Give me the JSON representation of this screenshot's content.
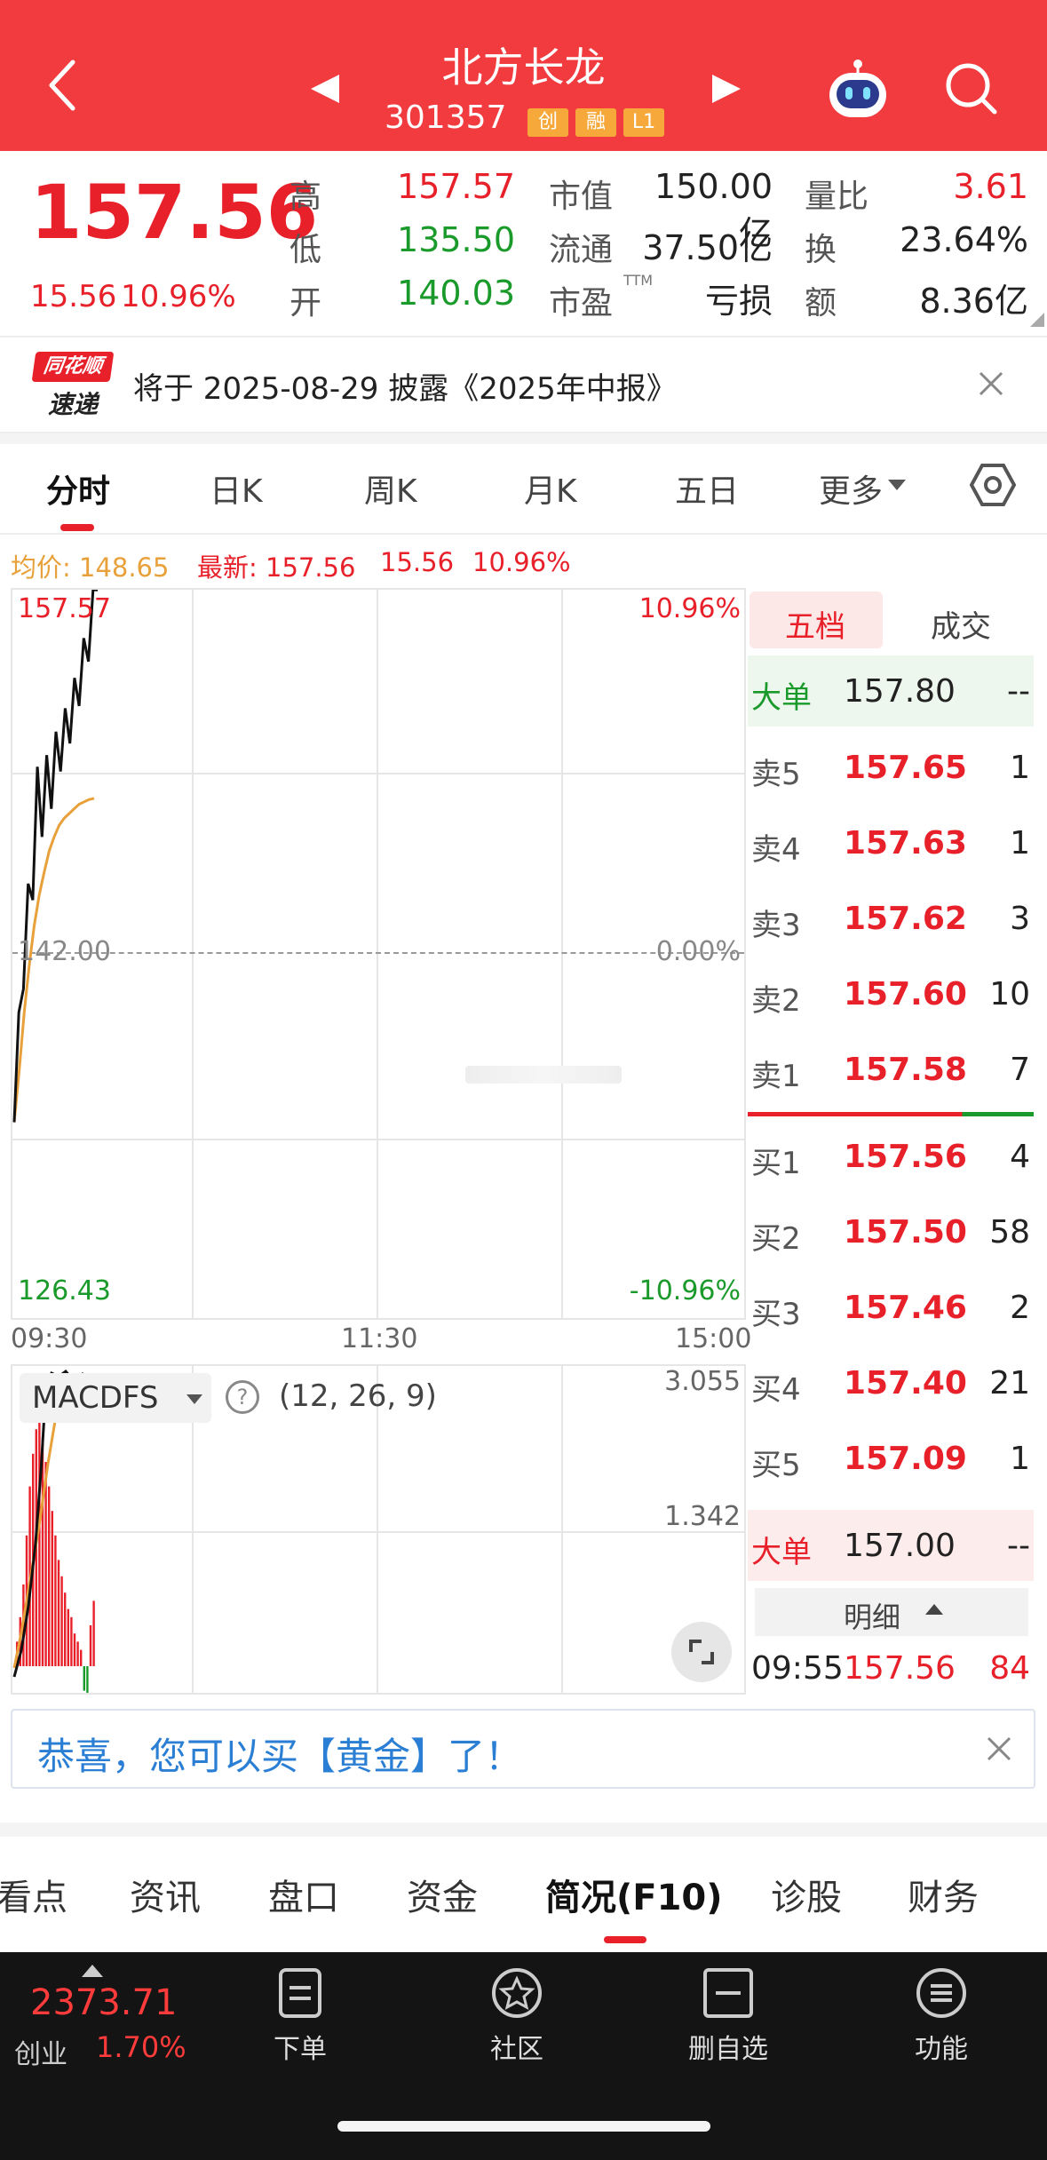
{
  "header": {
    "title": "北方长龙",
    "code": "301357",
    "tags": [
      "创",
      "融",
      "L1"
    ]
  },
  "quote": {
    "price": "157.56",
    "change": "15.56",
    "change_pct": "10.96%",
    "labels": {
      "high": "高",
      "low": "低",
      "open": "开",
      "mktcap": "市值",
      "float": "流通",
      "pe": "市盈",
      "pe_sup": "TTM",
      "vol_ratio": "量比",
      "turnover": "换",
      "amount": "额"
    },
    "values": {
      "high": "157.57",
      "low": "135.50",
      "open": "140.03",
      "mktcap": "150.00亿",
      "float": "37.50亿",
      "pe": "亏损",
      "vol_ratio": "3.61",
      "turnover": "23.64%",
      "amount": "8.36亿"
    }
  },
  "notice": {
    "logo_line1": "同花顺",
    "logo_line2": "速递",
    "text": "将于 2025-08-29 披露《2025年中报》"
  },
  "tabs": [
    "分时",
    "日K",
    "周K",
    "月K",
    "五日",
    "更多"
  ],
  "chart_info": {
    "avg_label": "均价: 148.65",
    "latest_label": "最新: 157.56",
    "change": "15.56",
    "change_pct": "10.96%"
  },
  "chart_data": {
    "type": "line",
    "y_top": "157.57",
    "y_mid": "142.00",
    "y_bottom": "126.43",
    "pct_top": "10.96%",
    "pct_mid": "0.00%",
    "pct_bottom": "-10.96%",
    "x_labels": [
      "09:30",
      "11:30",
      "15:00"
    ],
    "ylim": [
      126.43,
      157.57
    ],
    "series": [
      {
        "values": [
          134.8,
          139.5,
          140.5,
          145.0,
          144.3,
          150.0,
          147.0,
          150.5,
          148.2,
          151.5,
          149.8,
          152.5,
          151.0,
          153.8,
          152.6,
          155.5,
          154.5,
          157.57,
          157.56
        ]
      },
      {
        "values": [
          134.8,
          137.0,
          139.5,
          141.5,
          143.2,
          144.5,
          145.5,
          146.4,
          147.0,
          147.5,
          147.8,
          148.0,
          148.2,
          148.4,
          148.5,
          148.6,
          148.65
        ]
      }
    ]
  },
  "macd": {
    "label": "MACDFS",
    "params": "(12, 26, 9)",
    "top_value": "3.055",
    "mid_value": "1.342",
    "bars": [
      0.3,
      0.6,
      1.0,
      1.6,
      2.2,
      2.6,
      2.9,
      3.0,
      2.8,
      2.5,
      2.2,
      1.9,
      1.6,
      1.3,
      1.1,
      0.9,
      0.7,
      0.6,
      0.4,
      0.3,
      0.2,
      -0.3,
      -0.4,
      0.5,
      0.8
    ]
  },
  "orderbook": {
    "tabs": [
      "五档",
      "成交"
    ],
    "big_sell": {
      "label": "大单",
      "price": "157.80",
      "vol": "--"
    },
    "sells": [
      {
        "label": "卖5",
        "price": "157.65",
        "vol": "1"
      },
      {
        "label": "卖4",
        "price": "157.63",
        "vol": "1"
      },
      {
        "label": "卖3",
        "price": "157.62",
        "vol": "3"
      },
      {
        "label": "卖2",
        "price": "157.60",
        "vol": "10"
      },
      {
        "label": "卖1",
        "price": "157.58",
        "vol": "7"
      }
    ],
    "buys": [
      {
        "label": "买1",
        "price": "157.56",
        "vol": "4"
      },
      {
        "label": "买2",
        "price": "157.50",
        "vol": "58"
      },
      {
        "label": "买3",
        "price": "157.46",
        "vol": "2"
      },
      {
        "label": "买4",
        "price": "157.40",
        "vol": "21"
      },
      {
        "label": "买5",
        "price": "157.09",
        "vol": "1"
      }
    ],
    "big_buy": {
      "label": "大单",
      "price": "157.00",
      "vol": "--"
    },
    "detail_label": "明细",
    "trade": {
      "time": "09:55",
      "price": "157.56",
      "vol": "84"
    }
  },
  "banner": {
    "text": "恭喜，您可以买【黄金】了！"
  },
  "bottom_tabs": [
    "看点",
    "资讯",
    "盘口",
    "资金",
    "简况(F10)",
    "诊股",
    "财务"
  ],
  "bottombar": {
    "index_value": "2373.71",
    "index_name": "创业",
    "index_pct": "1.70%",
    "items": [
      "下单",
      "社区",
      "删自选",
      "功能"
    ]
  },
  "colors": {
    "header_red": "#f23b3f",
    "up_red": "#e8202a",
    "down_green": "#1a9a2a",
    "avg_orange": "#e8a13a"
  }
}
